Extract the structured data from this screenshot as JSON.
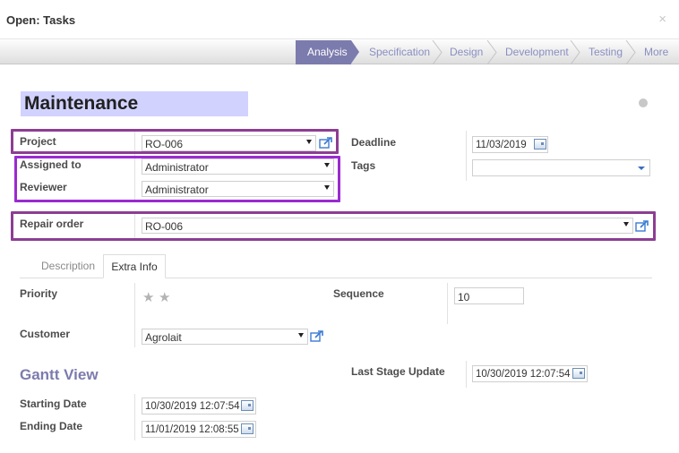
{
  "dialog": {
    "title": "Open: Tasks",
    "close_label": "×"
  },
  "stages": [
    {
      "label": "Analysis",
      "active": true
    },
    {
      "label": "Specification",
      "active": false
    },
    {
      "label": "Design",
      "active": false
    },
    {
      "label": "Development",
      "active": false
    },
    {
      "label": "Testing",
      "active": false
    },
    {
      "label": "More",
      "active": false
    }
  ],
  "task": {
    "name": "Maintenance"
  },
  "fields": {
    "project": {
      "label": "Project",
      "value": "RO-006"
    },
    "assigned_to": {
      "label": "Assigned to",
      "value": "Administrator"
    },
    "reviewer": {
      "label": "Reviewer",
      "value": "Administrator"
    },
    "deadline": {
      "label": "Deadline",
      "value": "11/03/2019"
    },
    "tags": {
      "label": "Tags",
      "value": ""
    },
    "repair_order": {
      "label": "Repair order",
      "value": "RO-006"
    }
  },
  "tabs": [
    {
      "label": "Description",
      "active": false
    },
    {
      "label": "Extra Info",
      "active": true
    }
  ],
  "extra": {
    "priority": {
      "label": "Priority",
      "stars": 2,
      "filled": 0
    },
    "sequence": {
      "label": "Sequence",
      "value": "10"
    },
    "customer": {
      "label": "Customer",
      "value": "Agrolait"
    },
    "gantt_title": "Gantt View",
    "last_stage_update": {
      "label": "Last Stage Update",
      "value": "10/30/2019 12:07:54"
    },
    "starting_date": {
      "label": "Starting Date",
      "value": "10/30/2019 12:07:54"
    },
    "ending_date": {
      "label": "Ending Date",
      "value": "11/01/2019 12:08:55"
    }
  },
  "colors": {
    "accent": "#7c7bad",
    "highlight": "#9a2bd0",
    "title_bg": "#d2d2ff"
  },
  "icons": {
    "external_link": "external-link-icon",
    "calendar": "calendar-icon",
    "close": "close-icon",
    "star": "star-icon"
  }
}
